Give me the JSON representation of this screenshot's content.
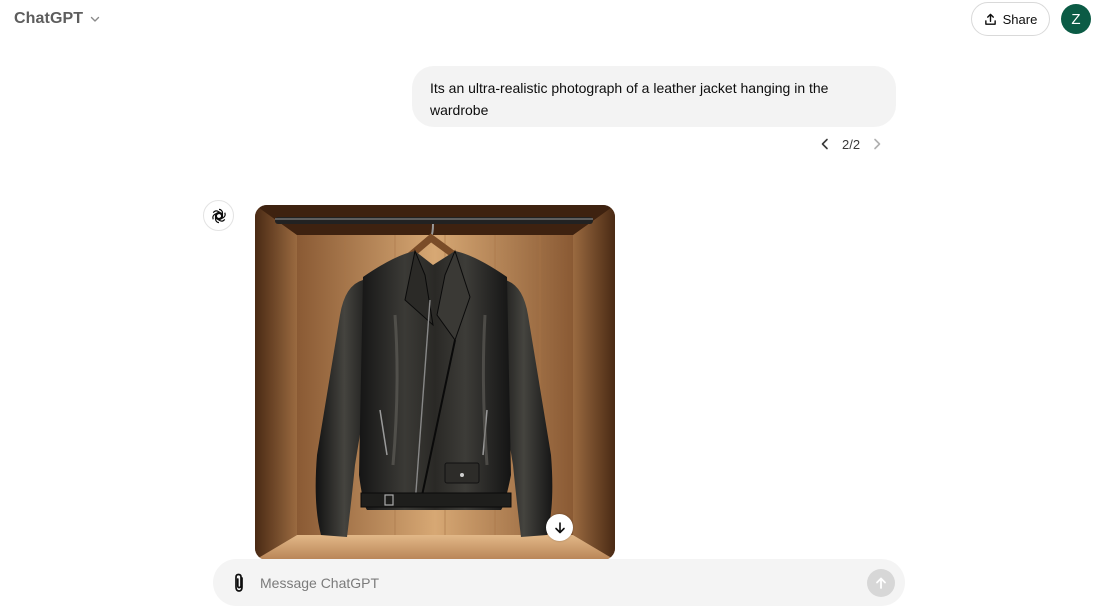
{
  "header": {
    "model_name": "ChatGPT",
    "share_label": "Share",
    "avatar_initial": "Z"
  },
  "conversation": {
    "user_message": "Its an ultra-realistic photograph of a leather jacket hanging in the wardrobe",
    "pager": "2/2"
  },
  "composer": {
    "placeholder": "Message ChatGPT"
  },
  "colors": {
    "avatar_bg": "#0b5b45",
    "bubble_bg": "#f3f3f3",
    "composer_bg": "#f4f4f4"
  },
  "icons": [
    "chevron-down-icon",
    "share-icon",
    "chevron-left-icon",
    "chevron-right-icon",
    "openai-logo-icon",
    "download-icon",
    "paperclip-icon",
    "arrow-up-icon"
  ]
}
